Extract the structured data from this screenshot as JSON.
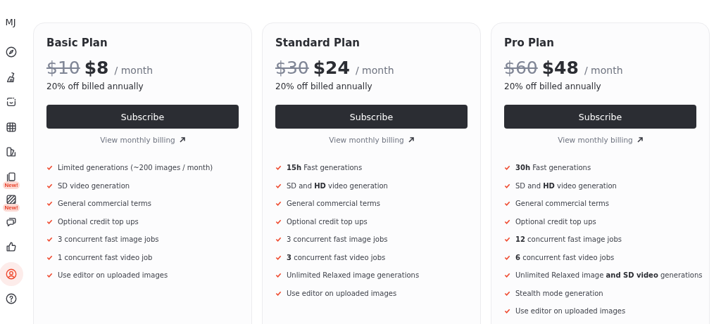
{
  "sidebar": {
    "logo": "MJ",
    "items": [
      {
        "selected": false
      },
      {
        "selected": false
      },
      {
        "selected": false
      },
      {
        "selected": false
      },
      {
        "selected": false
      },
      {
        "selected": false,
        "badge": "New!"
      },
      {
        "selected": false,
        "badge": "New!"
      },
      {
        "selected": false
      },
      {
        "selected": false
      },
      {
        "selected": true
      },
      {
        "selected": false
      }
    ]
  },
  "plans": [
    {
      "name": "Basic Plan",
      "old_price": "$10",
      "price": "$8",
      "period": "/ month",
      "discount": "20% off billed annually",
      "button": "Subscribe",
      "link": "View monthly billing",
      "features": [
        "Limited generations (~200 images / month)",
        "SD video generation",
        "General commercial terms",
        "Optional credit top ups",
        "3 concurrent fast image jobs",
        "1 concurrent fast video job",
        "Use editor on uploaded images"
      ]
    },
    {
      "name": "Standard Plan",
      "old_price": "$30",
      "price": "$24",
      "period": "/ month",
      "discount": "20% off billed annually",
      "button": "Subscribe",
      "link": "View monthly billing",
      "features": [
        "**15h** Fast generations",
        "SD and **HD** video generation",
        "General commercial terms",
        "Optional credit top ups",
        "3 concurrent fast image jobs",
        "**3** concurrent fast video jobs",
        "Unlimited Relaxed image generations",
        "Use editor on uploaded images"
      ]
    },
    {
      "name": "Pro Plan",
      "old_price": "$60",
      "price": "$48",
      "period": "/ month",
      "discount": "20% off billed annually",
      "button": "Subscribe",
      "link": "View monthly billing",
      "features": [
        "**30h** Fast generations",
        "SD and **HD** video generation",
        "General commercial terms",
        "Optional credit top ups",
        "**12** concurrent fast image jobs",
        "**6** concurrent fast video jobs",
        "Unlimited Relaxed image **and SD video** generations",
        "Stealth mode generation",
        "Use editor on uploaded images"
      ]
    }
  ]
}
